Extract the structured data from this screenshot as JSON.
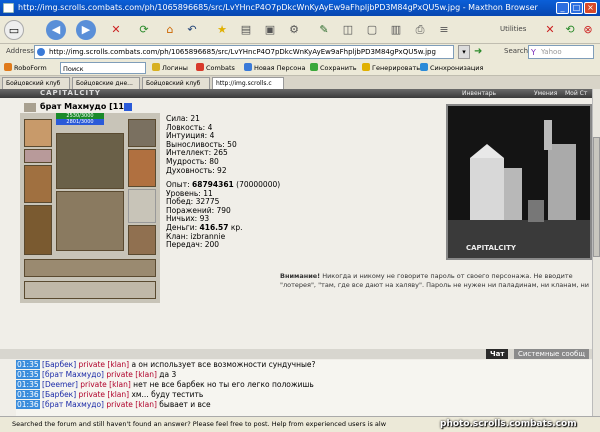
{
  "window": {
    "title": "http://img.scrolls.combats.com/ph/1065896685/src/LvYHncP4O7pDkcWnKyAyEw9aFhpljbPD3M84gPxQU5w.jpg - Maxthon Browser"
  },
  "toolbar": {
    "utilities_label": "Utilities",
    "search_label": "Search"
  },
  "address": {
    "label": "Address",
    "url": "http://img.scrolls.combats.com/ph/1065896685/src/LvYHncP4O7pDkcWnKyAyEw9aFhpljbPD3M84gPxQU5w.jpg",
    "search_placeholder": "Yahoo"
  },
  "links": [
    {
      "label": "RoboForm"
    },
    {
      "label": "Поиск"
    },
    {
      "label": "Логины"
    },
    {
      "label": "Combats"
    },
    {
      "label": "Новая Персона"
    },
    {
      "label": "Сохранить"
    },
    {
      "label": "Генерировать"
    },
    {
      "label": "Синхронизация"
    }
  ],
  "tabs": [
    {
      "label": "Бойцовский клуб"
    },
    {
      "label": "Бойцовские дне..."
    },
    {
      "label": "Бойцовский клуб"
    },
    {
      "label": "http://img.scrolls.c"
    }
  ],
  "game": {
    "logo": "CAPITALCITY",
    "nav": [
      "Инвентарь",
      "Умения",
      "Мой Ст"
    ],
    "char_name": "брат Махмудо [11]",
    "hp": "2530/3000",
    "mp": "2801/3000",
    "stats": [
      "Сила: 21",
      "Ловкость: 4",
      "Интуиция: 4",
      "Выносливость: 50",
      "Интеллект: 265",
      "Мудрость: 80",
      "Духовность: 92"
    ],
    "exp_label": "Опыт: ",
    "exp_value": "68794361",
    "exp_next": " (70000000)",
    "info": [
      "Уровень: 11",
      "Побед: 32775",
      "Поражений: 790",
      "Ничьих: 93"
    ],
    "money_label": "Деньги: ",
    "money_value": "416.57",
    "money_unit": " кр.",
    "clan": "Клан: izbrannie",
    "transfers": "Передач: 200",
    "pic_caption": "CAPITALCITY",
    "warn_bold": "Внимание!",
    "warn_text": " Никогда и никому не говорите пароль от своего персонажа. Не вводите \"лотерея\", \"там, где все дают на халяву\". Пароль не нужен ни паладинам, ни кланам, ни"
  },
  "chat": {
    "tabs": [
      "Чат",
      "Системные сообщ"
    ],
    "lines": [
      {
        "time": "01:35",
        "nick": "[Барбек]",
        "priv": "private [klan]",
        "text": " а он использует все возможности сундучные?"
      },
      {
        "time": "01:35",
        "nick": "[брат Махмудо]",
        "priv": "private [klan]",
        "text": " да 3"
      },
      {
        "time": "01:35",
        "nick": "[Deemer]",
        "priv": "private [klan]",
        "text": " нет не все барбек но ты его легко положишь"
      },
      {
        "time": "01:36",
        "nick": "[Барбек]",
        "priv": "private [klan]",
        "text": " хм... буду тестить"
      },
      {
        "time": "01:36",
        "nick": "[брат Махмудо]",
        "priv": "private [klan]",
        "text": " бывает и все"
      }
    ]
  },
  "status": {
    "text": "Searched the forum and still haven't found an answer? Please feel free to post. Help from experienced users is alw",
    "watermark": "photo.scrolls.combats.com"
  }
}
